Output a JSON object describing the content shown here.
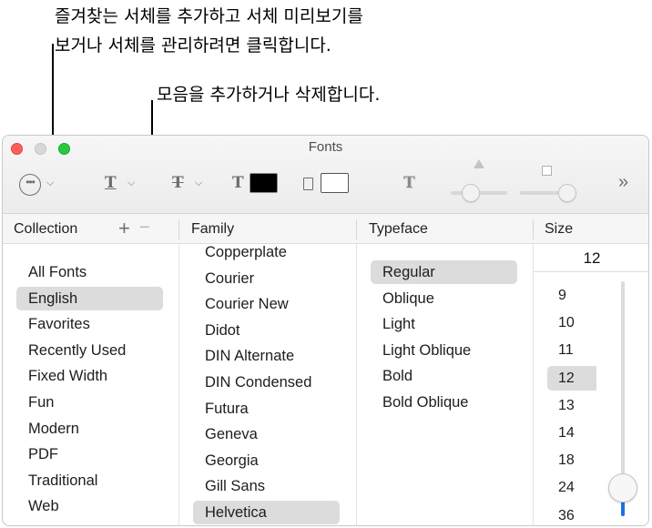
{
  "callouts": {
    "menu_line1": "즐겨찾는 서체를 추가하고 서체 미리보기를",
    "menu_line2": "보거나 서체를 관리하려면 클릭합니다.",
    "collection": "모음을 추가하거나 삭제합니다."
  },
  "window": {
    "title": "Fonts"
  },
  "toolbar": {
    "more_icon": "ellipsis-circle-icon",
    "underline_glyph": "T",
    "strike_glyph": "T",
    "color_glyph": "T",
    "shadow_glyph": "T",
    "text_color": "#000000",
    "doc_color": "#ffffff",
    "overflow_glyph": "»"
  },
  "columns": {
    "collection": "Collection",
    "family": "Family",
    "typeface": "Typeface",
    "size": "Size",
    "add_glyph": "+",
    "remove_glyph": "−"
  },
  "collections": [
    "All Fonts",
    "English",
    "Favorites",
    "Recently Used",
    "Fixed Width",
    "Fun",
    "Modern",
    "PDF",
    "Traditional",
    "Web"
  ],
  "selected_collection": "English",
  "families": [
    "Copperplate",
    "Courier",
    "Courier New",
    "Didot",
    "DIN Alternate",
    "DIN Condensed",
    "Futura",
    "Geneva",
    "Georgia",
    "Gill Sans",
    "Helvetica"
  ],
  "selected_family": "Helvetica",
  "typefaces": [
    "Regular",
    "Oblique",
    "Light",
    "Light Oblique",
    "Bold",
    "Bold Oblique"
  ],
  "selected_typeface": "Regular",
  "size": {
    "value": "12",
    "options": [
      "9",
      "10",
      "11",
      "12",
      "13",
      "14",
      "18",
      "24",
      "36"
    ],
    "selected": "12",
    "slider_fraction": 0.12
  }
}
